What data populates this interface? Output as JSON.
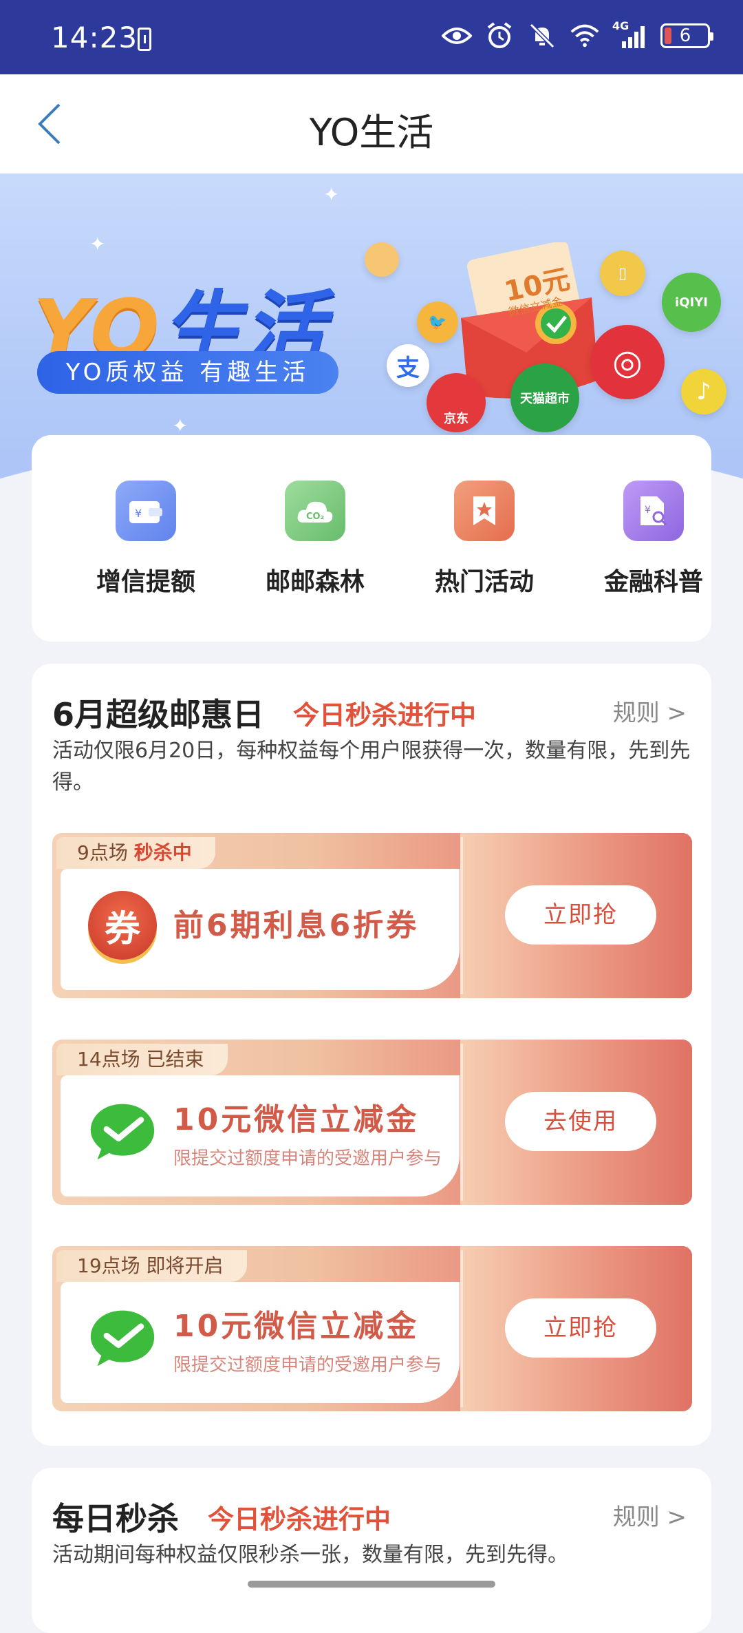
{
  "status_bar": {
    "time": "14:23",
    "battery": "6",
    "network": "4G",
    "icons": [
      "eye-icon",
      "alarm-icon",
      "mute-icon",
      "wifi-icon",
      "signal-icon",
      "battery-icon"
    ]
  },
  "nav": {
    "title": "YO生活"
  },
  "banner": {
    "brand_yo": "YO",
    "brand_shenghuo": "生活",
    "slogan": "YO质权益 有趣生活",
    "envelope_amount": "10元",
    "envelope_sub": "微信立减金",
    "bubbles": {
      "jd": "京东",
      "tmall": "天猫超市",
      "iqiyi": "iQIYI",
      "alipay": "支"
    }
  },
  "quick_links": [
    {
      "label": "增信提额",
      "icon": "wallet-icon",
      "color": "#6f8ef2"
    },
    {
      "label": "邮邮森林",
      "icon": "co2-icon",
      "color": "#79c97d"
    },
    {
      "label": "热门活动",
      "icon": "bookmark-star-icon",
      "color": "#ec7f5f"
    },
    {
      "label": "金融科普",
      "icon": "finance-doc-icon",
      "color": "#a27ae8"
    }
  ],
  "section1": {
    "title": "6月超级邮惠日",
    "hot": "今日秒杀进行中",
    "rule": "规则 >",
    "desc": "活动仅限6月20日，每种权益每个用户限获得一次，数量有限，先到先得。",
    "deals": [
      {
        "tag_time": "9点场",
        "tag_status": "秒杀中",
        "name": "前6期利息6折券",
        "sub": "",
        "button": "立即抢",
        "icon": "coupon-icon"
      },
      {
        "tag_time": "14点场",
        "tag_status": "已结束",
        "name": "10元微信立减金",
        "sub": "限提交过额度申请的受邀用户参与",
        "button": "去使用",
        "icon": "wechat-icon"
      },
      {
        "tag_time": "19点场",
        "tag_status": "即将开启",
        "name": "10元微信立减金",
        "sub": "限提交过额度申请的受邀用户参与",
        "button": "立即抢",
        "icon": "wechat-icon"
      }
    ]
  },
  "section2": {
    "title": "每日秒杀",
    "hot": "今日秒杀进行中",
    "rule": "规则 >",
    "desc": "活动期间每种权益仅限秒杀一张，数量有限，先到先得。"
  },
  "coupon_char": "券",
  "colors": {
    "status_bar": "#2e3a9b",
    "accent_red": "#e0533a",
    "brand_blue": "#2f64e8",
    "brand_orange": "#f7a63a"
  }
}
